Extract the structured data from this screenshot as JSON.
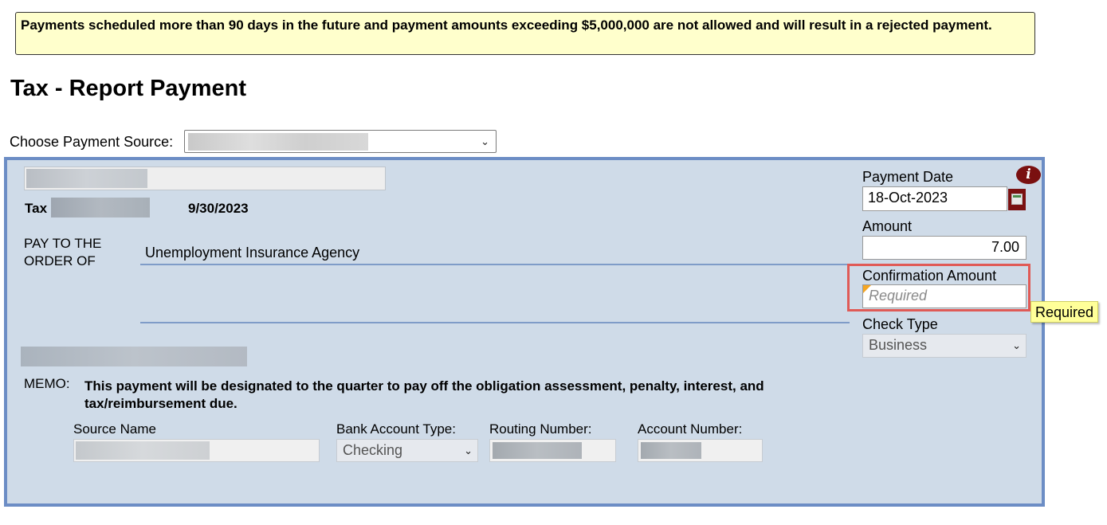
{
  "notice": "Payments scheduled more than 90 days in the future and payment amounts exceeding $5,000,000 are not allowed and will result in a rejected payment.",
  "page_title": "Tax - Report Payment",
  "payment_source": {
    "label": "Choose Payment Source:",
    "chevron": "chevron-down-icon"
  },
  "check": {
    "tax_label": "Tax",
    "quarter_date": "9/30/2023",
    "pay_to_label": "PAY TO THE ORDER OF",
    "payee": "Unemployment Insurance Agency",
    "memo_label": "MEMO:",
    "memo_text": "This payment will be designated to the quarter to pay off the obligation assessment, penalty, interest, and tax/reimbursement due."
  },
  "side": {
    "payment_date_label": "Payment Date",
    "payment_date_value": "18-Oct-2023",
    "amount_label": "Amount",
    "amount_value": "7.00",
    "confirmation_label": "Confirmation Amount",
    "confirmation_placeholder": "Required",
    "check_type_label": "Check Type",
    "check_type_value": "Business",
    "info_icon": "i"
  },
  "bank": {
    "source_name_label": "Source Name",
    "account_type_label": "Bank Account Type:",
    "account_type_value": "Checking",
    "routing_label": "Routing Number:",
    "account_number_label": "Account Number:"
  },
  "tooltip": "Required",
  "colors": {
    "notice_bg": "#ffffcc",
    "panel_bg": "#cfdbe8",
    "panel_border": "#6c8dc5",
    "highlight": "#e05a56",
    "tooltip_bg": "#ffff99"
  }
}
